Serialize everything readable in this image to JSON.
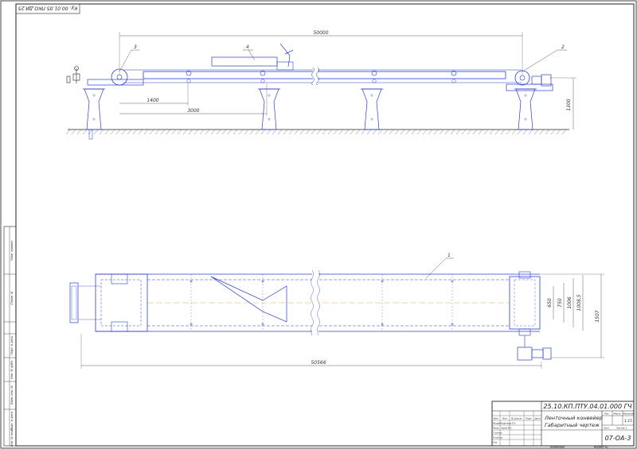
{
  "drawing": {
    "top_stamp": "Ку. 00.01.05.ПКО.ДИ.25",
    "views": {
      "elevation": {
        "dimensions": {
          "overall_length": "50000",
          "span_a": "1400",
          "span_b": "3000",
          "height": "1300"
        },
        "callouts": [
          "3",
          "4",
          "2"
        ]
      },
      "plan": {
        "dimensions": {
          "overall_length": "50566",
          "d1": "650",
          "d2": "750",
          "d3": "1006",
          "d4": "1008,5",
          "d5": "1507"
        },
        "callouts": [
          "1"
        ]
      }
    },
    "left_margin": {
      "boxes": [
        "Перв. примен.",
        "Справ. №",
        "Подп. и дата",
        "Инв. № дубл.",
        "Взам. инв. №",
        "Подп. и дата",
        "Инв. № подл."
      ]
    },
    "title_block": {
      "doc_code": "25.10.КП.ПТУ.04.01.000 ГЧ",
      "title_line1": "Ленточный конвейер",
      "title_line2": "Габаритный чертеж",
      "headers": [
        "Изм.",
        "Лист",
        "№ докум.",
        "Подп.",
        "Дата"
      ],
      "roles": [
        "Разраб.",
        "Пров.",
        "Т.контр.",
        "Н.контр.",
        "Утв."
      ],
      "names": [
        "Кудинова Е.А.",
        "Сарай В.С."
      ],
      "right_headers": [
        "Лит.",
        "Масса",
        "Масштаб"
      ],
      "scale": "1:15",
      "sheet_label": "Лист",
      "sheets_label": "Листов 1",
      "group": "07-ОА-3",
      "copied": "Копировал",
      "format": "Формат А1"
    }
  },
  "colors": {
    "line_blue": "#2b3fd0",
    "line_black": "#222222",
    "paper": "#ffffff"
  }
}
